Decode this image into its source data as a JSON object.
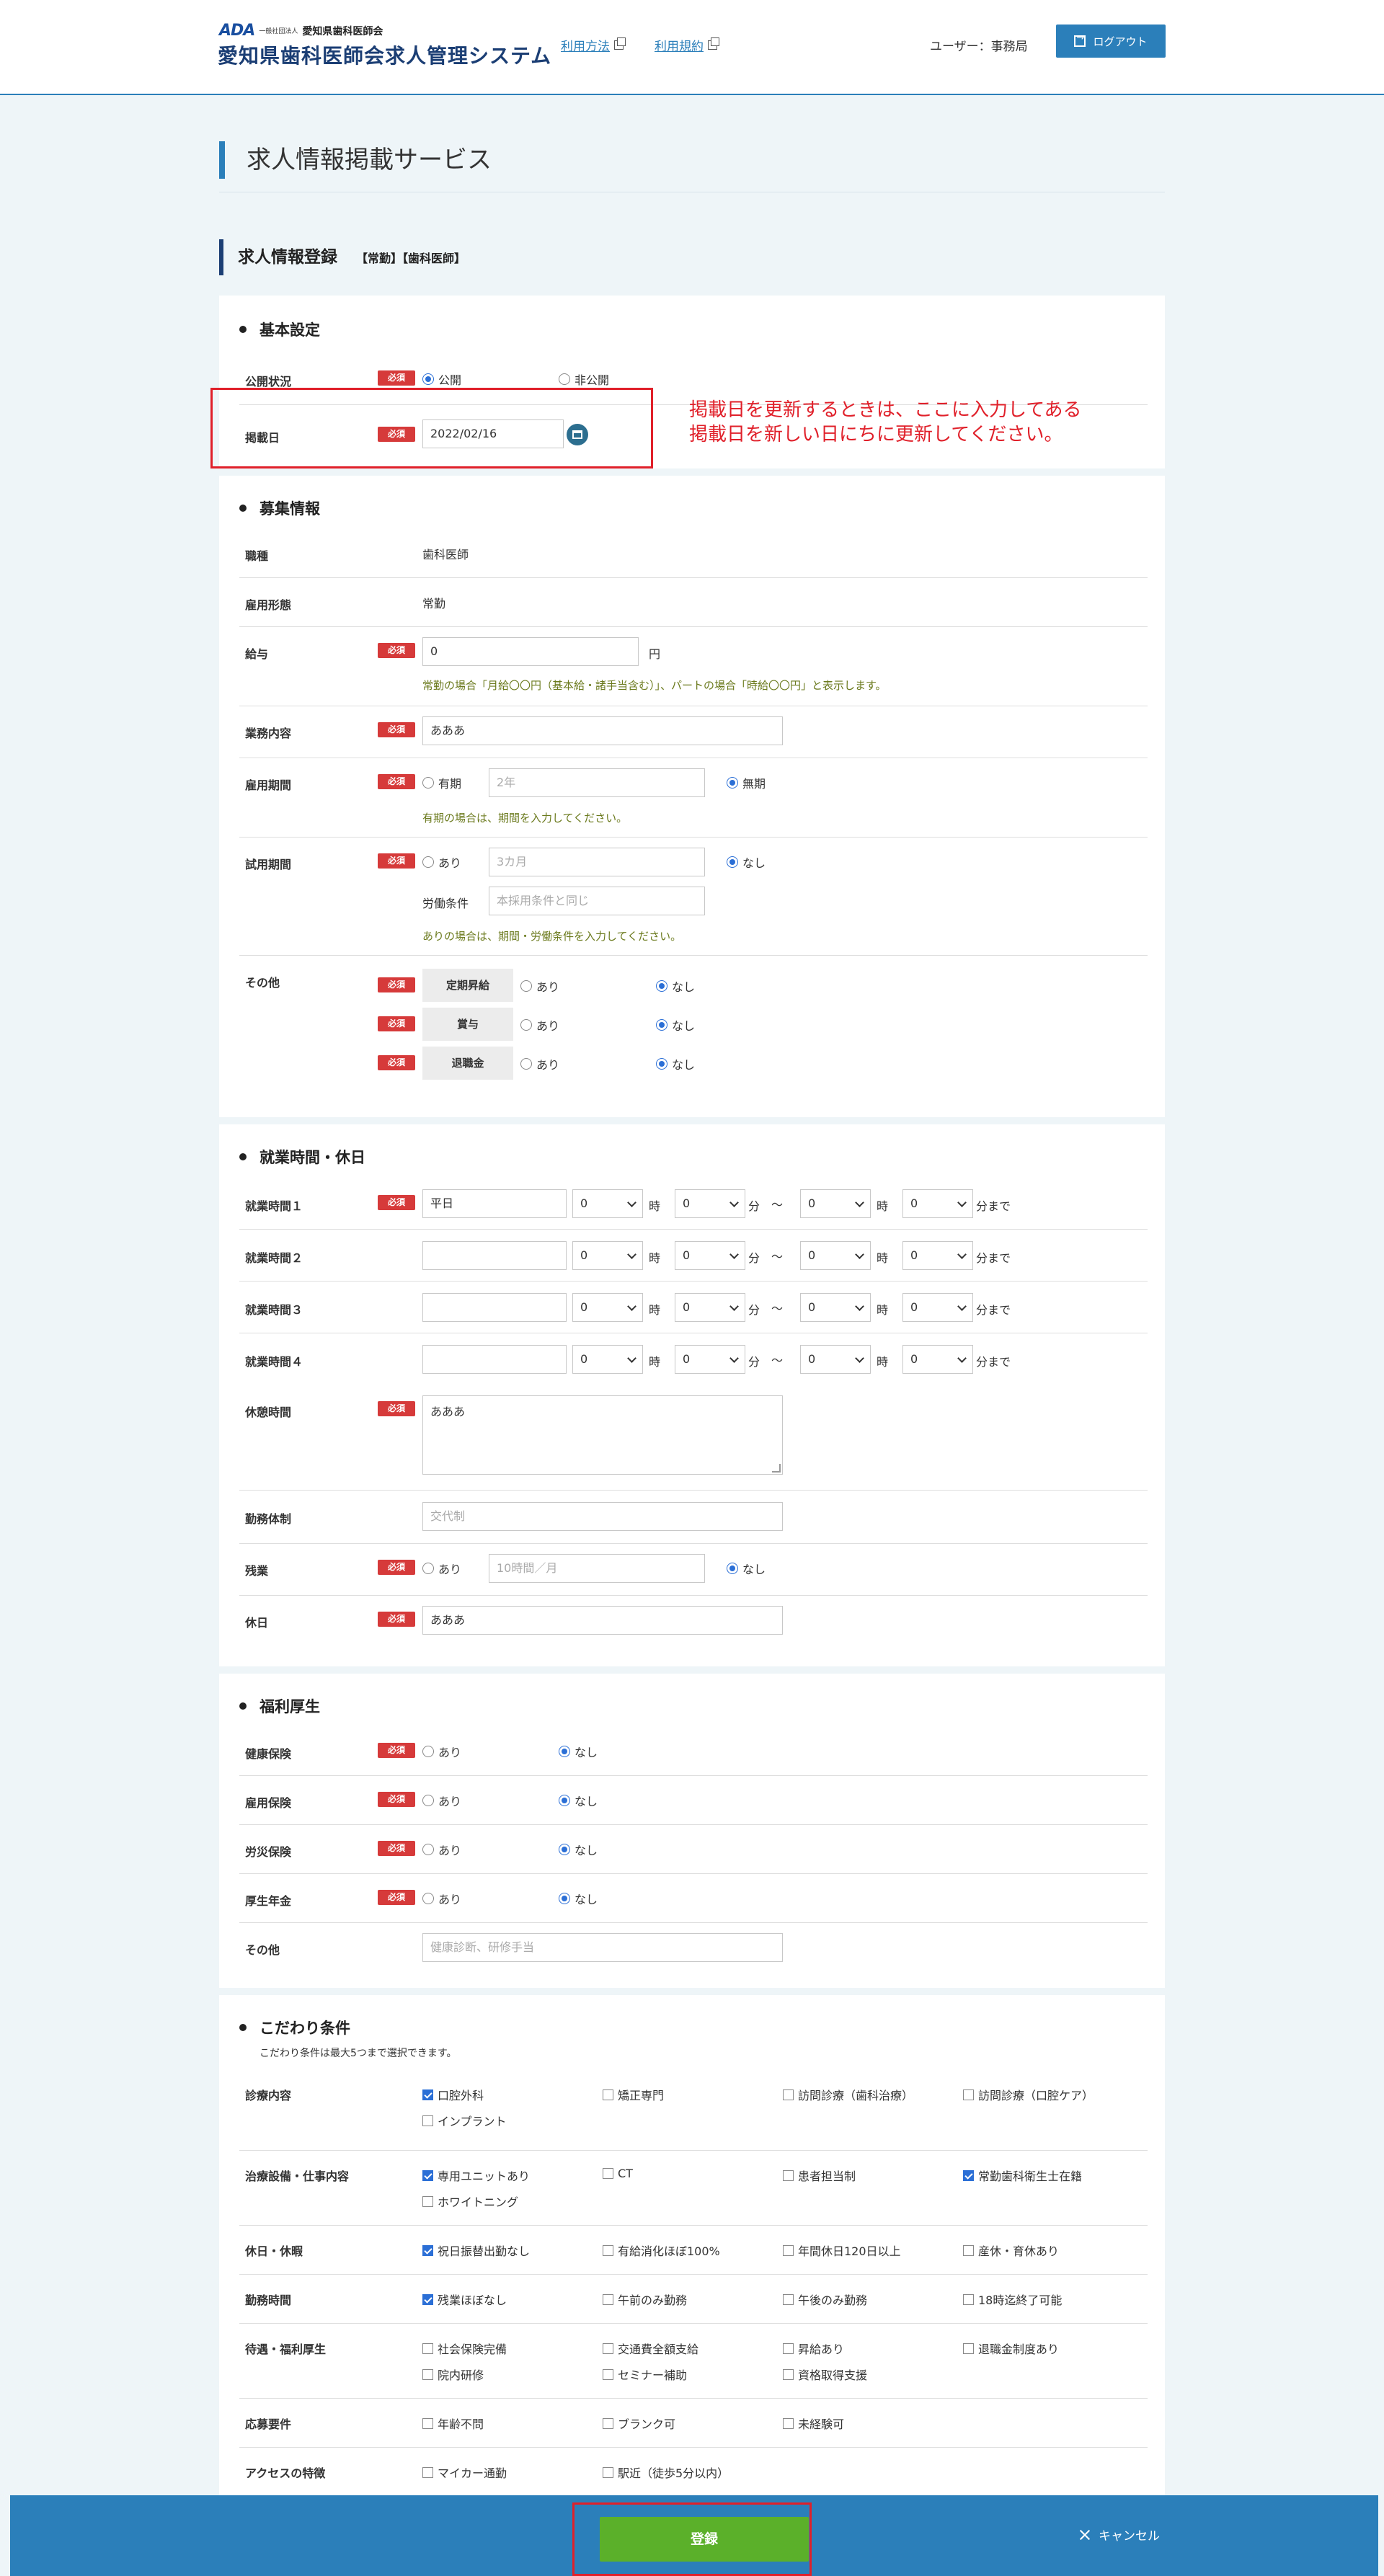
{
  "header": {
    "logo_mark": "ADA",
    "logo_sub": "一般社団法人",
    "logo_assoc": "愛知県歯科医師会",
    "system_title": "愛知県歯科医師会求人管理システム",
    "link_usage": "利用方法",
    "link_terms": "利用規約",
    "user_label": "ユーザー：事務局",
    "logout_label": "ログアウト"
  },
  "page": {
    "title": "求人情報掲載サービス",
    "subtitle": "求人情報登録",
    "subtitle_tags": "【常勤】【歯科医師】"
  },
  "annotation": {
    "line1": "掲載日を更新するときは、ここに入力してある",
    "line2": "掲載日を新しい日にちに更新してください。"
  },
  "required_label": "必須",
  "basic": {
    "heading": "基本設定",
    "status_label": "公開状況",
    "status_public": "公開",
    "status_private": "非公開",
    "date_label": "掲載日",
    "date_value": "2022/02/16"
  },
  "recruit": {
    "heading": "募集情報",
    "job_label": "職種",
    "job_value": "歯科医師",
    "employ_label": "雇用形態",
    "employ_value": "常勤",
    "salary_label": "給与",
    "salary_value": "0",
    "salary_unit": "円",
    "salary_hint": "常勤の場合「月給〇〇円（基本給・諸手当含む）」、パートの場合「時給〇〇円」と表示します。",
    "work_label": "業務内容",
    "work_value": "あああ",
    "period_label": "雇用期間",
    "period_fixed": "有期",
    "period_placeholder": "2年",
    "period_none": "無期",
    "period_hint": "有期の場合は、期間を入力してください。",
    "trial_label": "試用期間",
    "trial_yes": "あり",
    "trial_placeholder": "3カ月",
    "trial_no": "なし",
    "trial_cond_label": "労働条件",
    "trial_cond_placeholder": "本採用条件と同じ",
    "trial_hint": "ありの場合は、期間・労働条件を入力してください。",
    "other_label": "その他",
    "other_raise": "定期昇給",
    "other_bonus": "賞与",
    "other_retire": "退職金",
    "yes": "あり",
    "no": "なし"
  },
  "hours": {
    "heading": "就業時間・休日",
    "row1_label": "就業時間１",
    "row2_label": "就業時間２",
    "row3_label": "就業時間３",
    "row4_label": "就業時間４",
    "row1_value": "平日",
    "select_value": "0",
    "hour_unit": "時",
    "min_unit": "分",
    "tilde": "〜",
    "until": "分まで",
    "break_label": "休憩時間",
    "break_value": "あああ",
    "shift_label": "勤務体制",
    "shift_placeholder": "交代制",
    "overtime_label": "残業",
    "overtime_yes": "あり",
    "overtime_placeholder": "10時間／月",
    "overtime_no": "なし",
    "holiday_label": "休日",
    "holiday_value": "あああ"
  },
  "welfare": {
    "heading": "福利厚生",
    "health_label": "健康保険",
    "employ_ins_label": "雇用保険",
    "accident_label": "労災保険",
    "pension_label": "厚生年金",
    "other_label": "その他",
    "other_placeholder": "健康診断、研修手当",
    "yes": "あり",
    "no": "なし"
  },
  "prefs": {
    "heading": "こだわり条件",
    "note": "こだわり条件は最大5つまで選択できます。",
    "groups": [
      {
        "label": "診療内容",
        "items": [
          "口腔外科",
          "矯正専門",
          "訪問診療（歯科治療）",
          "訪問診療（口腔ケア）",
          "インプラント"
        ]
      },
      {
        "label": "治療設備・仕事内容",
        "items": [
          "専用ユニットあり",
          "CT",
          "患者担当制",
          "常勤歯科衛生士在籍",
          "ホワイトニング"
        ]
      },
      {
        "label": "休日・休暇",
        "items": [
          "祝日振替出勤なし",
          "有給消化ほぼ100%",
          "年間休日120日以上",
          "産休・育休あり"
        ]
      },
      {
        "label": "勤務時間",
        "items": [
          "残業ほぼなし",
          "午前のみ勤務",
          "午後のみ勤務",
          "18時迄終了可能"
        ]
      },
      {
        "label": "待遇・福利厚生",
        "items": [
          "社会保険完備",
          "交通費全額支給",
          "昇給あり",
          "退職金制度あり",
          "院内研修",
          "セミナー補助",
          "資格取得支援"
        ]
      },
      {
        "label": "応募要件",
        "items": [
          "年齢不問",
          "ブランク可",
          "未経験可"
        ]
      },
      {
        "label": "アクセスの特徴",
        "items": [
          "マイカー通勤",
          "駅近（徒歩5分以内）"
        ]
      }
    ]
  },
  "footer": {
    "submit_label": "登録",
    "cancel_label": "キャンセル"
  }
}
